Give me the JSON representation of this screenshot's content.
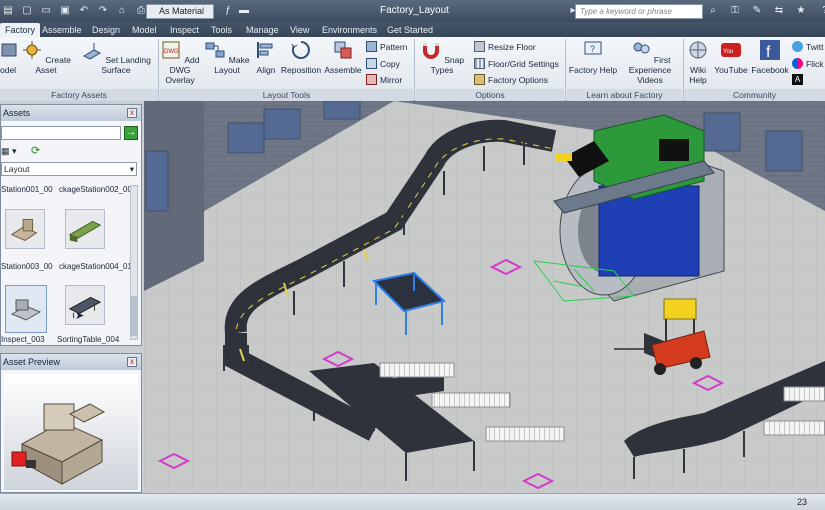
{
  "titlebar": {
    "title": "Factory_Layout",
    "style_select": "As Material",
    "search_placeholder": "Type a keyword or phrase",
    "help_label": "?"
  },
  "tabs": [
    "Factory",
    "Assemble",
    "Design",
    "Model",
    "Inspect",
    "Tools",
    "Manage",
    "View",
    "Environments",
    "Get Started"
  ],
  "ribbon": {
    "factory_assets": {
      "group_label": "Factory Assets",
      "model_label": "odel",
      "create_asset": "Create Asset",
      "set_landing": "Set Landing Surface"
    },
    "layout_tools": {
      "group_label": "Layout Tools",
      "add_dwg": "Add DWG",
      "overlay": "Overlay",
      "make_layout": "Make Layout",
      "align": "Align",
      "reposition": "Reposition",
      "assemble": "Assemble",
      "pattern": "Pattern",
      "copy": "Copy",
      "mirror": "Mirror"
    },
    "options": {
      "group_label": "Options",
      "snap_types": "Snap Types",
      "resize_floor": "Resize Floor",
      "floor_grid": "Floor/Grid Settings",
      "factory_options": "Factory Options"
    },
    "learn": {
      "group_label": "Learn about Factory",
      "factory_help": "Factory Help",
      "first_experience": "First Experience",
      "videos": "Videos"
    },
    "community": {
      "group_label": "Community",
      "wiki_help": "Wiki",
      "help": "Help",
      "youtube": "YouTube",
      "facebook": "Facebook",
      "twitter": "Twitt",
      "flickr": "Flick"
    }
  },
  "assets_panel": {
    "title": "Assets",
    "combo_value": "Layout",
    "items": [
      "Station001_00",
      "ckageStation002_00",
      "Station003_00",
      "ckageStation004_01",
      "Inspect_003",
      "SortingTable_004"
    ]
  },
  "preview_panel": {
    "title": "Asset Preview"
  },
  "status": {
    "page_number": "23"
  },
  "colors": {
    "ribbon_bg": "#eef2f7",
    "titlebar_bg": "#3d4b5e",
    "floor": "#c6c9c7",
    "wall": "#6e7686",
    "conveyor_belt": "#3b3f47",
    "machine_green": "#2c9a3a",
    "machine_blue": "#1f3fb5",
    "forklift_red": "#d43a1d",
    "forklift_yellow": "#f3d21f",
    "marker_magenta": "#d23cc9"
  }
}
